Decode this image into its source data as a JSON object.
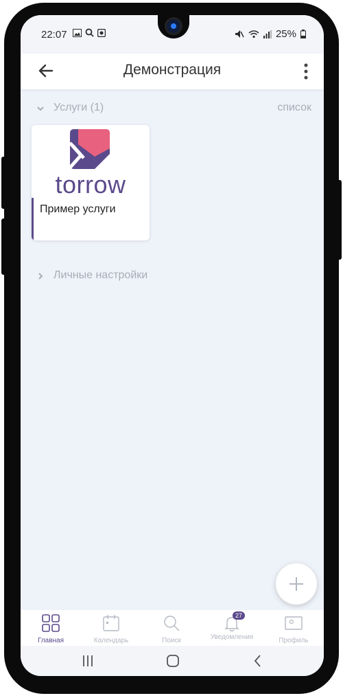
{
  "status": {
    "time": "22:07",
    "battery": "25%"
  },
  "appbar": {
    "title": "Демонстрация"
  },
  "services_section": {
    "label": "Услуги (1)",
    "action": "список"
  },
  "service_card": {
    "logo_text": "torrow",
    "title": "Пример услуги"
  },
  "settings_section": {
    "label": "Личные настройки"
  },
  "bottom_nav": {
    "items": [
      {
        "label": "Главная",
        "icon": "home-grid-icon"
      },
      {
        "label": "Календарь",
        "icon": "calendar-icon"
      },
      {
        "label": "Поиск",
        "icon": "search-icon"
      },
      {
        "label": "Уведомления",
        "icon": "bell-icon",
        "badge": "27"
      },
      {
        "label": "Профиль",
        "icon": "profile-card-icon"
      }
    ]
  },
  "colors": {
    "accent": "#5b4a8b",
    "logo_pink": "#e8617f",
    "background": "#eef2f9"
  }
}
